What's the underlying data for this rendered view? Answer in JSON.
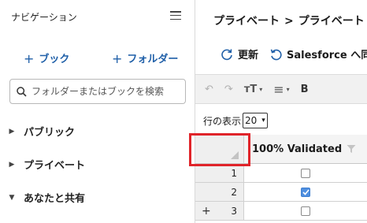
{
  "sidebar": {
    "title": "ナビゲーション",
    "add_book": "ブック",
    "add_folder": "フォルダー",
    "add_symbol": "+",
    "search_placeholder": "フォルダーまたはブックを検索",
    "tree": [
      {
        "label": "パブリック",
        "caret": "▶"
      },
      {
        "label": "プライベート",
        "caret": "▶"
      },
      {
        "label": "あなたと共有",
        "caret": "▼"
      }
    ]
  },
  "main": {
    "breadcrumb": [
      "プライベート",
      "プライベート"
    ],
    "breadcrumb_sep": ">",
    "actions": {
      "refresh": "更新",
      "salesforce": "Salesforce へ同"
    },
    "toolbar": {
      "undo": "↶",
      "redo": "↷",
      "text_size": "тT",
      "align": "≡",
      "bold": "B",
      "dropdown": "▾"
    },
    "rows_label": "行の表示",
    "rows_value": "20",
    "rows_arrow": "▾",
    "grid": {
      "column_header": "100% Validated",
      "rows": [
        {
          "num": "1",
          "checked": false,
          "plus": ""
        },
        {
          "num": "2",
          "checked": true,
          "plus": ""
        },
        {
          "num": "3",
          "checked": false,
          "plus": "+"
        }
      ]
    }
  },
  "colors": {
    "accent": "#1f5fa8",
    "highlight": "#e0242a",
    "checkbox": "#4f8fe0"
  }
}
